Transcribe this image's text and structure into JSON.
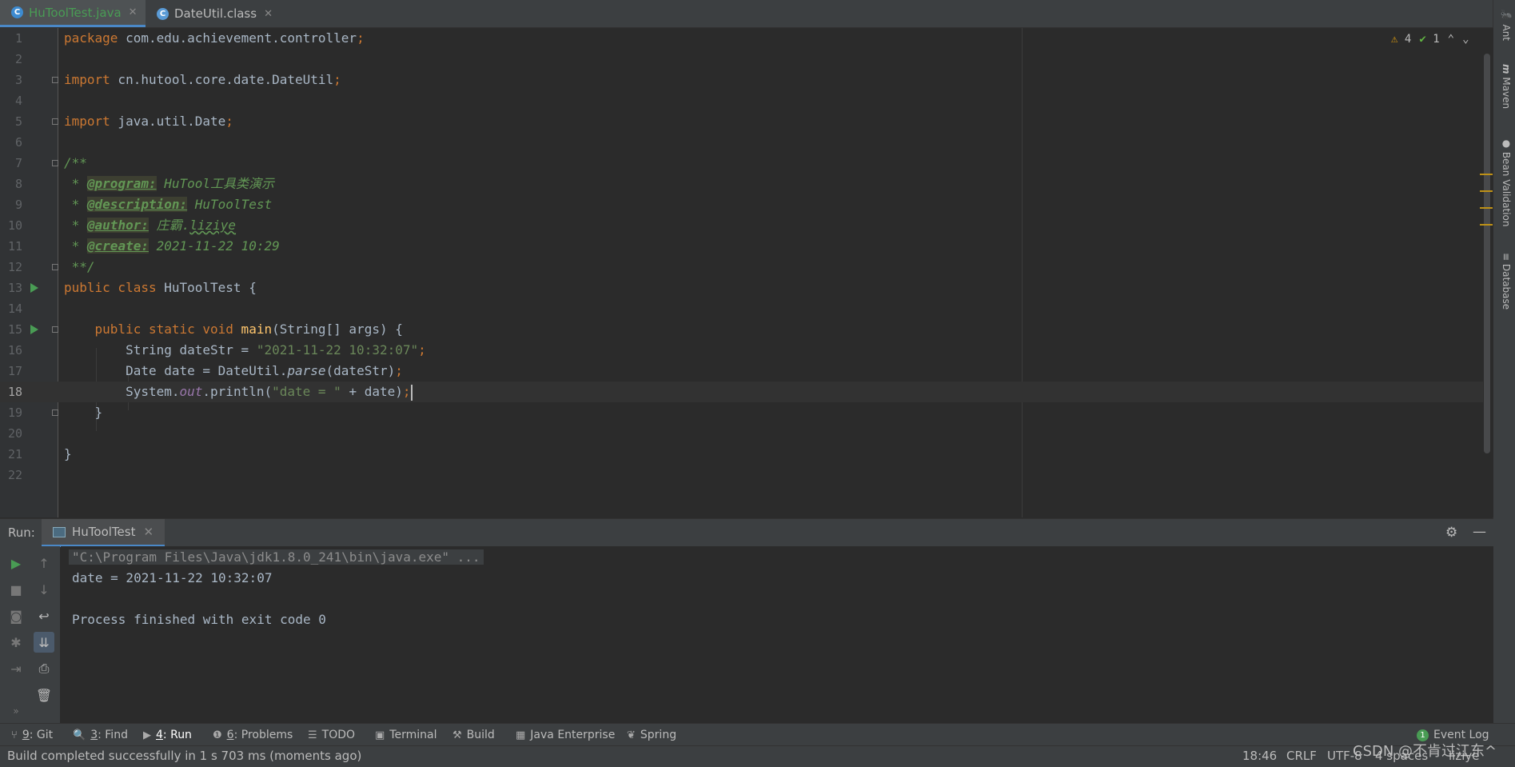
{
  "tabs": [
    {
      "label": "HuToolTest.java",
      "icon": "java-class-icon",
      "active": true
    },
    {
      "label": "DateUtil.class",
      "icon": "compiled-class-icon",
      "active": false
    }
  ],
  "right_tools": [
    "Ant",
    "Maven",
    "Bean Validation",
    "Database"
  ],
  "inspections": {
    "warnings": "4",
    "typos": "1"
  },
  "editor": {
    "line_numbers": [
      "1",
      "2",
      "3",
      "4",
      "5",
      "6",
      "7",
      "8",
      "9",
      "10",
      "11",
      "12",
      "13",
      "14",
      "15",
      "16",
      "17",
      "18",
      "19",
      "20",
      "21",
      "22"
    ],
    "l1": {
      "kw": "package",
      "rest": " com.edu.achievement.controller",
      "semi": ";"
    },
    "l3": {
      "kw": "import",
      "rest": " cn.hutool.core.date.DateUtil",
      "semi": ";"
    },
    "l5": {
      "kw": "import",
      "rest": " java.util.Date",
      "semi": ";"
    },
    "l7": {
      "text": "/**"
    },
    "l8": {
      "star": " * ",
      "tag": "@program:",
      "val": " HuTool工具类演示"
    },
    "l9": {
      "star": " * ",
      "tag": "@description:",
      "val": " HuToolTest"
    },
    "l10": {
      "star": " * ",
      "tag": "@author:",
      "val1": " 庄霸.",
      "val2": "liziye"
    },
    "l11": {
      "star": " * ",
      "tag": "@create:",
      "val": " 2021-11-22 10:29"
    },
    "l12": {
      "text": " **/"
    },
    "l13": {
      "kw": "public class",
      "rest": " HuToolTest {"
    },
    "l15": {
      "kw": "public static void",
      "fn": " main",
      "rest": "(String[] args) {"
    },
    "l16": {
      "pre": "String dateStr = ",
      "str": "\"2021-11-22 10:32:07\"",
      "semi": ";"
    },
    "l17": {
      "pre": "Date date = DateUtil.",
      "ital": "parse",
      "post": "(dateStr)",
      "semi": ";"
    },
    "l18": {
      "pre": "System.",
      "stat": "out",
      "mid": ".println(",
      "str": "\"date = \"",
      "post": " + date)",
      "semi": ";"
    },
    "l19": {
      "text": "}"
    },
    "l21": {
      "text": "}"
    }
  },
  "run": {
    "label": "Run:",
    "tab": "HuToolTest",
    "console": {
      "command": "\"C:\\Program Files\\Java\\jdk1.8.0_241\\bin\\java.exe\" ...",
      "output": "date = 2021-11-22 10:32:07",
      "exit": "Process finished with exit code 0"
    }
  },
  "toolwindows": [
    {
      "num": "9",
      "label": ": Git",
      "icon": "git-branch-icon"
    },
    {
      "num": "3",
      "label": ": Find",
      "icon": "search-icon"
    },
    {
      "num": "4",
      "label": ": Run",
      "icon": "run-icon"
    },
    {
      "num": "6",
      "label": ": Problems",
      "icon": "problems-icon"
    },
    {
      "num": "",
      "label": "TODO",
      "icon": "list-icon"
    },
    {
      "num": "",
      "label": "Terminal",
      "icon": "terminal-icon"
    },
    {
      "num": "",
      "label": "Build",
      "icon": "hammer-icon"
    },
    {
      "num": "",
      "label": "Java Enterprise",
      "icon": "java-enterprise-icon"
    },
    {
      "num": "",
      "label": "Spring",
      "icon": "spring-leaf-icon"
    }
  ],
  "event_log": {
    "count": "1",
    "label": "Event Log"
  },
  "status": {
    "message": "Build completed successfully in 1 s 703 ms (moments ago)",
    "position": "18:46",
    "line_sep": "CRLF",
    "encoding": "UTF-8",
    "indent": "4 spaces",
    "user": "liziye"
  },
  "watermark": "CSDN @不肯过江东^"
}
